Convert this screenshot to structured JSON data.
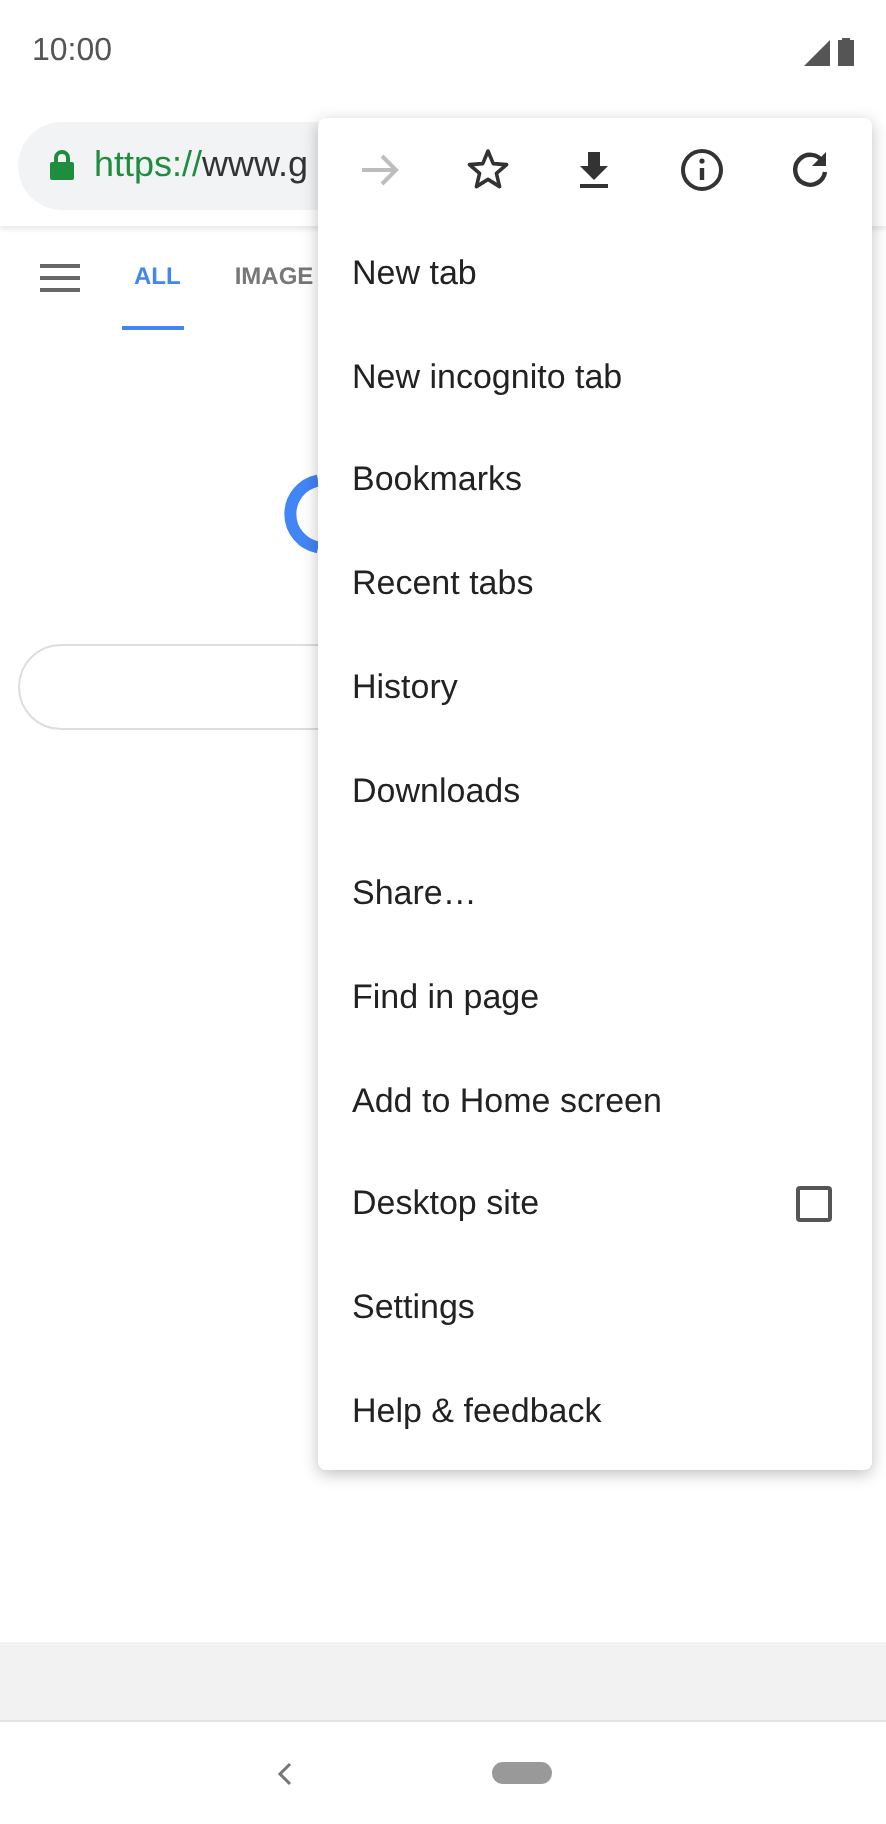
{
  "status_bar": {
    "time": "10:00"
  },
  "address_bar": {
    "scheme": "https://",
    "host": "www.g"
  },
  "page_tabs": [
    {
      "label": "ALL",
      "selected": true
    },
    {
      "label": "IMAGE",
      "selected": false
    }
  ],
  "menu": {
    "toolbar": [
      {
        "kind": "forward",
        "disabled": true
      },
      {
        "kind": "bookmark",
        "disabled": false
      },
      {
        "kind": "download",
        "disabled": false
      },
      {
        "kind": "info",
        "disabled": false
      },
      {
        "kind": "reload",
        "disabled": false
      }
    ],
    "items": [
      {
        "kind": "plain",
        "label": "New tab"
      },
      {
        "kind": "plain",
        "label": "New incognito tab"
      },
      {
        "kind": "plain",
        "label": "Bookmarks"
      },
      {
        "kind": "plain",
        "label": "Recent tabs"
      },
      {
        "kind": "plain",
        "label": "History"
      },
      {
        "kind": "plain",
        "label": "Downloads"
      },
      {
        "kind": "plain",
        "label": "Share…"
      },
      {
        "kind": "plain",
        "label": "Find in page"
      },
      {
        "kind": "plain",
        "label": "Add to Home screen"
      },
      {
        "kind": "checkbox",
        "label": "Desktop site",
        "checked": false
      },
      {
        "kind": "plain",
        "label": "Settings"
      },
      {
        "kind": "plain",
        "label": "Help & feedback"
      }
    ]
  }
}
